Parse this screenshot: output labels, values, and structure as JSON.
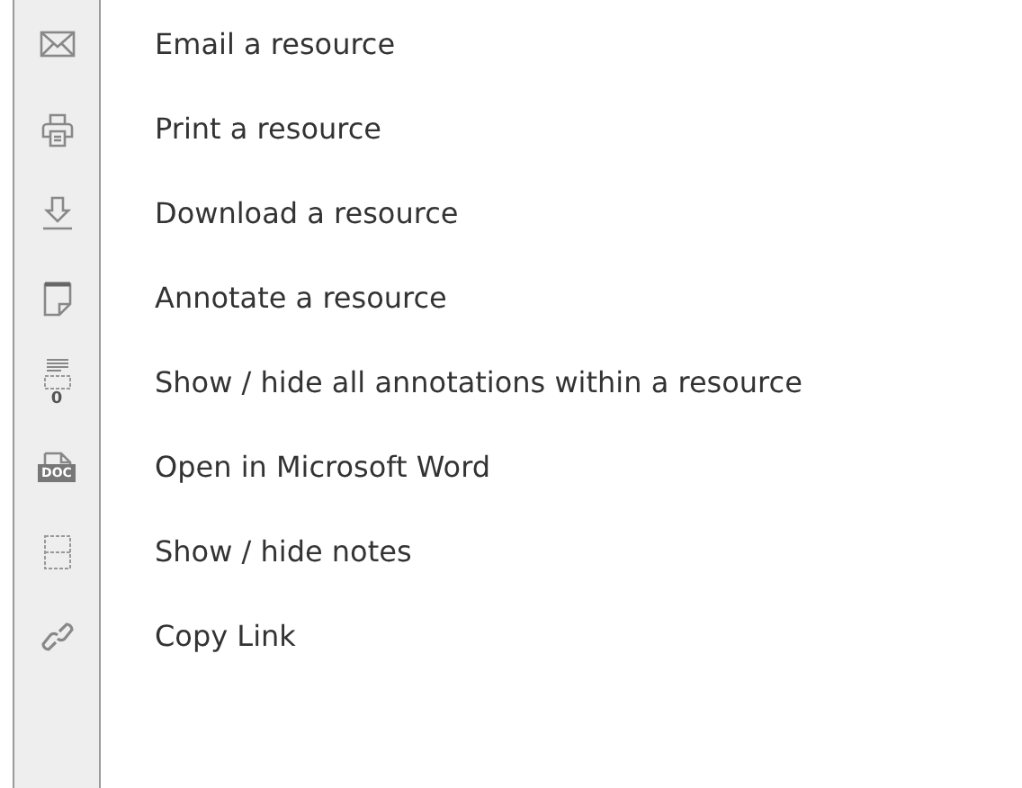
{
  "items": [
    {
      "kind": "email",
      "label": "Email a resource"
    },
    {
      "kind": "print",
      "label": "Print a resource"
    },
    {
      "kind": "download",
      "label": "Download a resource"
    },
    {
      "kind": "annotate",
      "label": "Annotate a resource"
    },
    {
      "kind": "annotations",
      "label": "Show / hide all annotations within a resource",
      "icon_text": "0"
    },
    {
      "kind": "word",
      "label": "Open in Microsoft Word",
      "icon_text": "DOC"
    },
    {
      "kind": "notes",
      "label": "Show / hide notes"
    },
    {
      "kind": "link",
      "label": "Copy Link"
    }
  ]
}
